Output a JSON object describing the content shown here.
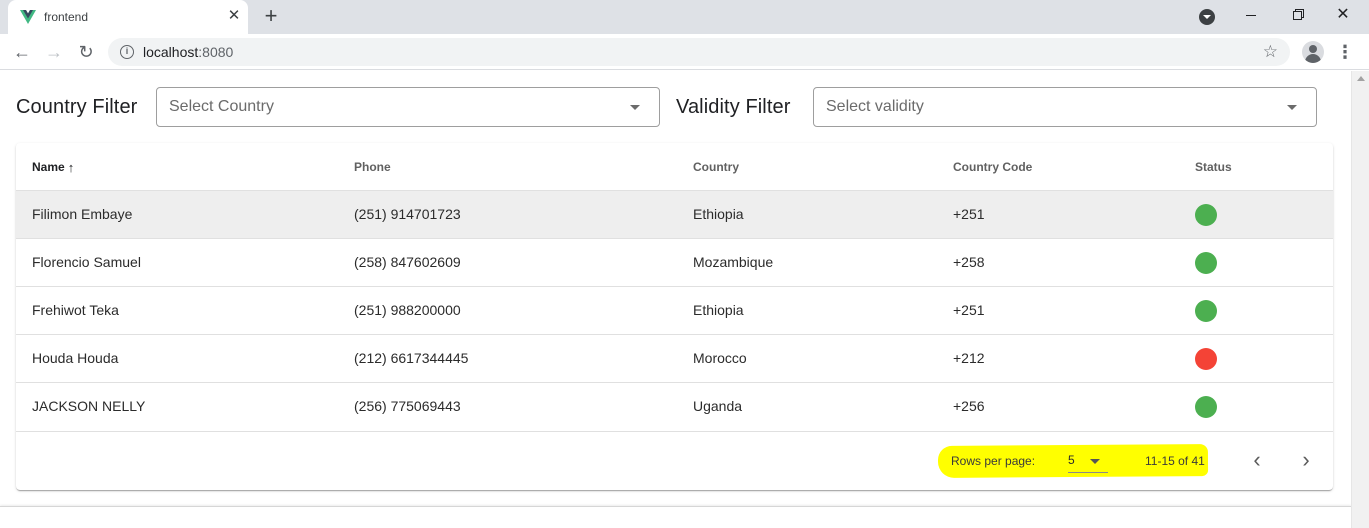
{
  "browser": {
    "tab_title": "frontend",
    "tab_close": "✕",
    "new_tab": "+",
    "url_host": "localhost",
    "url_port": ":8080",
    "brand_colors": {
      "vue_green": "#41b883",
      "vue_dark": "#35495e"
    }
  },
  "filters": {
    "country_label": "Country Filter",
    "country_placeholder": "Select Country",
    "validity_label": "Validity Filter",
    "validity_placeholder": "Select validity"
  },
  "table": {
    "headers": {
      "name": "Name",
      "phone": "Phone",
      "country": "Country",
      "code": "Country Code",
      "status": "Status"
    },
    "sort": {
      "column": "name",
      "direction": "ascending"
    },
    "rows": [
      {
        "name": "Filimon Embaye",
        "phone": "(251) 914701723",
        "country": "Ethiopia",
        "code": "+251",
        "valid": true
      },
      {
        "name": "Florencio Samuel",
        "phone": "(258) 847602609",
        "country": "Mozambique",
        "code": "+258",
        "valid": true
      },
      {
        "name": "Frehiwot Teka",
        "phone": "(251) 988200000",
        "country": "Ethiopia",
        "code": "+251",
        "valid": true
      },
      {
        "name": "Houda Houda",
        "phone": "(212) 6617344445",
        "country": "Morocco",
        "code": "+212",
        "valid": false
      },
      {
        "name": "JACKSON NELLY",
        "phone": "(256) 775069443",
        "country": "Uganda",
        "code": "+256",
        "valid": true
      }
    ],
    "status_colors": {
      "valid": "#4caf50",
      "invalid": "#f44336"
    },
    "hovered_row": 0
  },
  "pagination": {
    "rows_per_page_label": "Rows per page:",
    "rows_per_page": "5",
    "range": "11-15 of 41",
    "prev_icon": "‹",
    "next_icon": "›"
  },
  "annotation": {
    "highlight_color": "#ffff00"
  }
}
